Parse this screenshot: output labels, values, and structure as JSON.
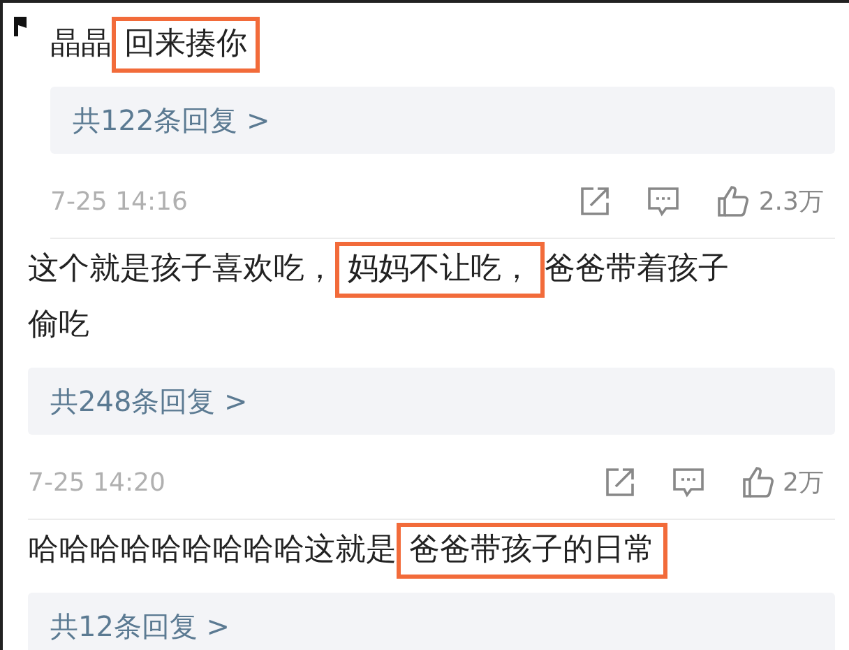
{
  "comments": [
    {
      "segments": [
        {
          "text": "晶晶 ",
          "highlighted": false
        },
        {
          "text": "回来揍你",
          "highlighted": true
        }
      ],
      "replies": "共122条回复 >",
      "meta": {
        "time": "7-25 14:16",
        "likes": "2.3万"
      }
    },
    {
      "segments": [
        {
          "text": "这个就是孩子喜欢吃，",
          "highlighted": false
        },
        {
          "text": "妈妈不让吃，",
          "highlighted": true
        },
        {
          "text": "爸爸带着孩子",
          "highlighted": false
        },
        {
          "text": "偷吃",
          "highlighted": false
        }
      ],
      "replies": "共248条回复 >",
      "meta": {
        "time": "7-25 14:20",
        "likes": "2万"
      }
    },
    {
      "segments": [
        {
          "text": "哈哈哈哈哈哈哈哈哈这就是",
          "highlighted": false
        },
        {
          "text": "爸爸带孩子的日常",
          "highlighted": true
        }
      ],
      "replies": "共12条回复 >"
    }
  ]
}
